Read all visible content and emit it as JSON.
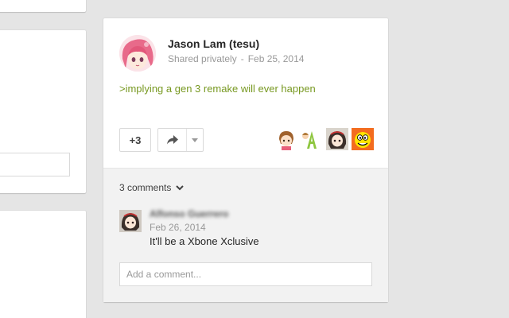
{
  "post": {
    "author_name": "Jason Lam (tesu)",
    "visibility": "Shared privately",
    "separator": "-",
    "date": "Feb 25, 2014",
    "text": ">implying a gen 3 remake will ever happen",
    "text_color": "#789922",
    "plus_count": "+3"
  },
  "comments": {
    "count_label": "3 comments",
    "items": [
      {
        "author": "Alfonso Guerrero",
        "date": "Feb 26, 2014",
        "text": "It'll be a Xbone Xclusive"
      }
    ],
    "input_placeholder": "Add a comment..."
  },
  "icons": {
    "share": "share-arrow-icon",
    "dropdown": "caret-down-icon",
    "expand": "chevron-down-icon"
  },
  "colors": {
    "background": "#e5e5e5",
    "card": "#ffffff",
    "comments_bg": "#f2f2f2"
  }
}
